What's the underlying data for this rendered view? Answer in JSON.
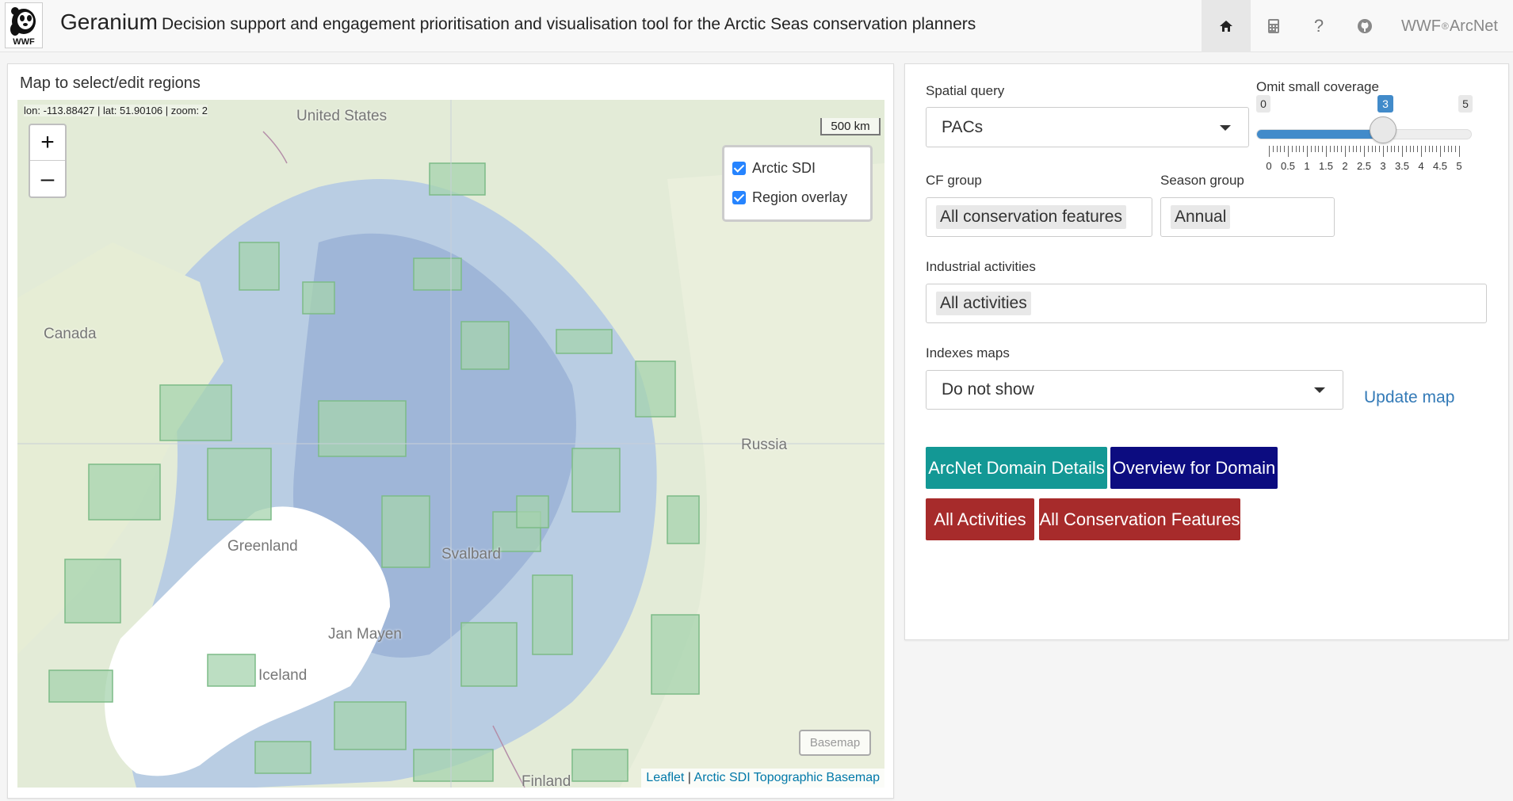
{
  "app": {
    "title": "Geranium",
    "subtitle": "Decision support and engagement prioritisation and visualisation tool for the Arctic Seas conservation planners",
    "logo_text": "WWF"
  },
  "nav": {
    "home_icon": "home-icon",
    "calculator_icon": "calculator-icon",
    "help_label": "?",
    "github_icon": "github-icon",
    "brand_prefix": "WWF",
    "brand_sup": "®",
    "brand_suffix": " ArcNet"
  },
  "map_panel": {
    "title": "Map to select/edit regions",
    "coords": "lon: -113.88427 | lat: 51.90106 | zoom: 2",
    "zoom_in": "+",
    "zoom_out": "–",
    "scale": "500 km",
    "layers": [
      {
        "label": "Arctic SDI",
        "checked": true
      },
      {
        "label": "Region overlay",
        "checked": true
      }
    ],
    "basemap_button": "Basemap",
    "attribution_leaflet": "Leaflet",
    "attribution_sep": " | ",
    "attribution_basemap": "Arctic SDI Topographic Basemap",
    "place_labels": {
      "united_states": "United States",
      "canada": "Canada",
      "russia": "Russia",
      "greenland": "Greenland",
      "svalbard": "Svalbard",
      "jan_mayen": "Jan Mayen",
      "iceland": "Iceland",
      "finland": "Finland"
    }
  },
  "controls": {
    "spatial_query": {
      "label": "Spatial query",
      "value": "PACs"
    },
    "omit_small": {
      "label": "Omit small coverage",
      "min": 0,
      "max": 5,
      "value": 3,
      "min_label": "0",
      "max_label": "5",
      "value_label": "3",
      "tick_labels": [
        "0",
        "0.5",
        "1",
        "1.5",
        "2",
        "2.5",
        "3",
        "3.5",
        "4",
        "4.5",
        "5"
      ]
    },
    "cf_group": {
      "label": "CF group",
      "value": "All conservation features"
    },
    "season_group": {
      "label": "Season group",
      "value": "Annual"
    },
    "industrial": {
      "label": "Industrial activities",
      "value": "All activities"
    },
    "indexes": {
      "label": "Indexes maps",
      "value": "Do not show"
    },
    "update_map": "Update map",
    "buttons": {
      "arcnet_domain": "ArcNet Domain Details",
      "overview_domain": "Overview for Domain",
      "all_activities": "All Activities",
      "all_conservation": "All Conservation Features"
    },
    "colors": {
      "teal": "#139895",
      "navy": "#0c0c80",
      "red": "#a72b2b",
      "slider_blue": "#428bca"
    }
  }
}
